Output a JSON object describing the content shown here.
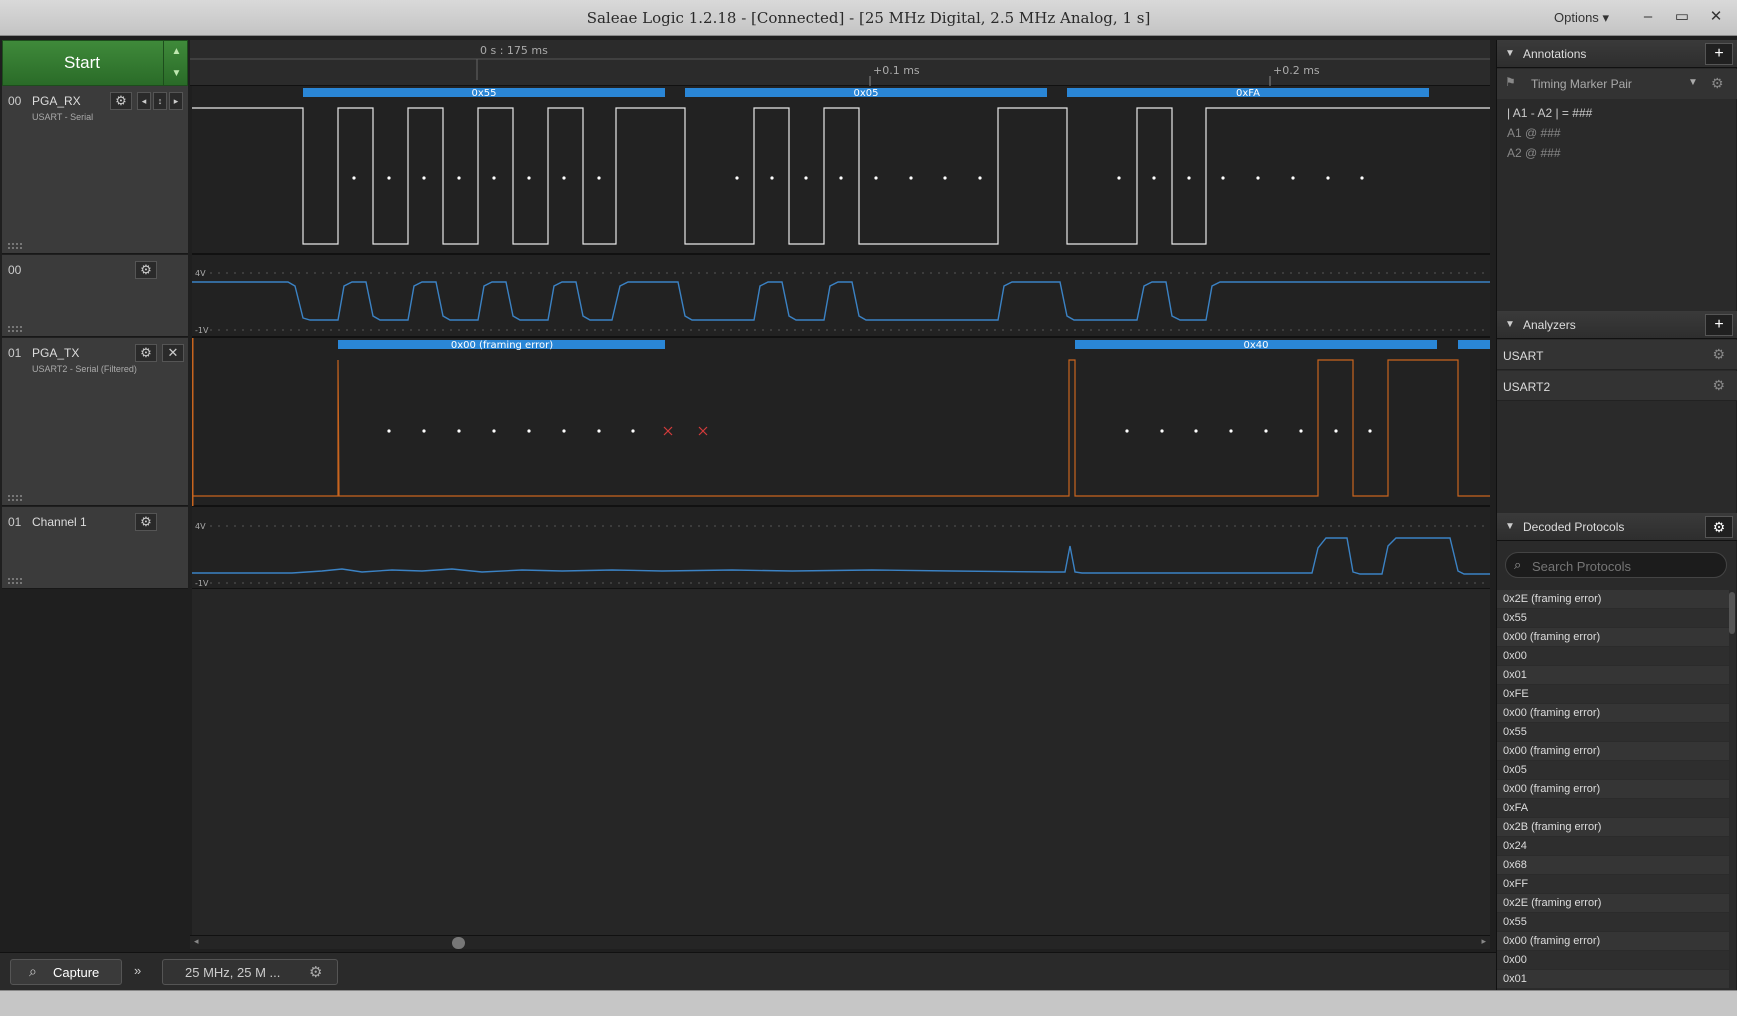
{
  "window": {
    "title": "Saleae Logic 1.2.18 - [Connected] - [25 MHz Digital, 2.5 MHz Analog, 1 s]",
    "options_label": "Options",
    "minimize": "–",
    "maximize": "▭",
    "close": "✕"
  },
  "toolbar": {
    "start_label": "Start"
  },
  "ruler": {
    "offset_label": "0 s : 175 ms",
    "tick1": "+0.1 ms",
    "tick2": "+0.2 ms"
  },
  "channels": [
    {
      "num": "00",
      "name": "PGA_RX",
      "sub": "USART - Serial"
    },
    {
      "num": "00",
      "name": "",
      "sub": ""
    },
    {
      "num": "01",
      "name": "PGA_TX",
      "sub": "USART2 - Serial (Filtered)"
    },
    {
      "num": "01",
      "name": "Channel 1",
      "sub": ""
    }
  ],
  "analog_scale": {
    "top": "4V",
    "bottom": "-1V"
  },
  "rx_decodes": [
    "0x55",
    "0x05",
    "0xFA"
  ],
  "tx_decodes": [
    "0x00 (framing error)",
    "0x40"
  ],
  "annotations": {
    "header": "Annotations",
    "marker": "Timing Marker Pair",
    "row1": "| A1 - A2 | = ###",
    "row2": "A1 @ ###",
    "row3": "A2 @ ###"
  },
  "analyzers": {
    "header": "Analyzers",
    "items": [
      "USART",
      "USART2"
    ]
  },
  "decoded": {
    "header": "Decoded Protocols",
    "search_placeholder": "Search Protocols",
    "items": [
      "0x2E (framing error)",
      "0x55",
      "0x00 (framing error)",
      "0x00",
      "0x01",
      "0xFE",
      "0x00 (framing error)",
      "0x55",
      "0x00 (framing error)",
      "0x05",
      "0x00 (framing error)",
      "0xFA",
      "0x2B (framing error)",
      "0x24",
      "0x68",
      "0xFF",
      "0x2E (framing error)",
      "0x55",
      "0x00 (framing error)",
      "0x00",
      "0x01"
    ]
  },
  "bottom": {
    "capture_label": "Capture",
    "session_label": "25 MHz, 25 M ..."
  },
  "colors": {
    "accent_green": "#2f7a2c",
    "decode_blue": "#2a86d6",
    "tx_orange": "#c8641e",
    "analog_blue": "#3b82c4"
  }
}
